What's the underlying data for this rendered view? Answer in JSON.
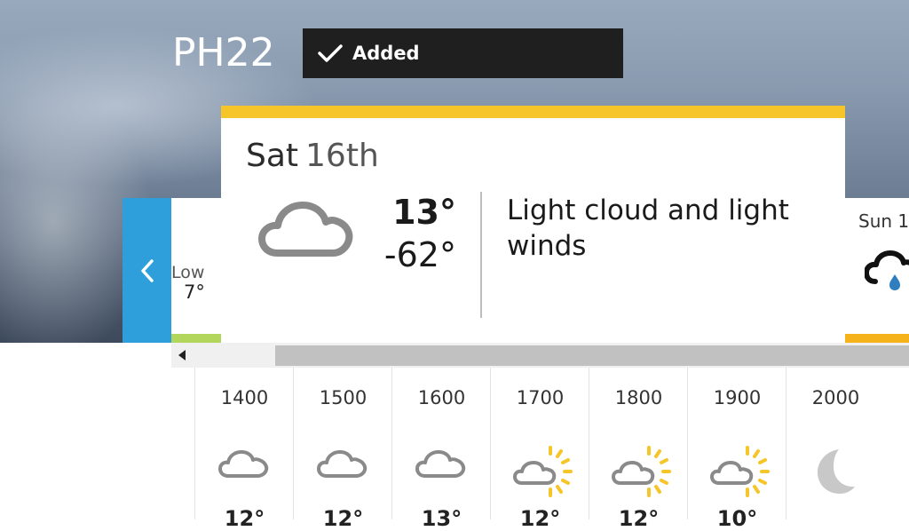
{
  "header": {
    "location": "PH22",
    "added_label": "Added"
  },
  "prev_day": {
    "low_label": "Low",
    "low_value": "7°"
  },
  "selected_day": {
    "day_name": "Sat",
    "day_num": "16th",
    "high": "13°",
    "low": "-62°",
    "description": "Light cloud and light winds",
    "icon": "light-cloud-icon"
  },
  "next_day": {
    "label": "Sun 1",
    "icon": "cloud-rain-icon"
  },
  "hourly": [
    {
      "time": "1400",
      "icon": "cloud-icon",
      "temp": "12°"
    },
    {
      "time": "1500",
      "icon": "cloud-icon",
      "temp": "12°"
    },
    {
      "time": "1600",
      "icon": "cloud-icon",
      "temp": "13°"
    },
    {
      "time": "1700",
      "icon": "sun-cloud-icon",
      "temp": "12°"
    },
    {
      "time": "1800",
      "icon": "sun-cloud-icon",
      "temp": "12°"
    },
    {
      "time": "1900",
      "icon": "sun-cloud-icon",
      "temp": "10°"
    },
    {
      "time": "2000",
      "icon": "moon-icon",
      "temp": ""
    }
  ],
  "colors": {
    "accent_blue": "#2f9fdc",
    "selected_bar": "#f5c52a",
    "prev_bar": "#b2d65c",
    "next_bar": "#f6b21a",
    "sun": "#f5c52a"
  }
}
